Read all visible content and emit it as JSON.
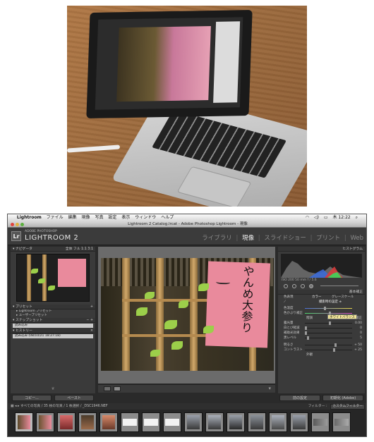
{
  "menubar": {
    "apple": "",
    "app": "Lightroom",
    "items": [
      "ファイル",
      "編集",
      "現像",
      "写真",
      "設定",
      "表示",
      "ウィンドウ",
      "ヘルプ"
    ],
    "clock": "木 12:22"
  },
  "window": {
    "title": "Lightroom 2 Catalog.lrcat - Adobe Photoshop Lightroom - 現像"
  },
  "identity": {
    "logo": "Lr",
    "adobe": "ADOBE PHOTOSHOP",
    "product": "LIGHTROOM 2",
    "modules": [
      "ライブラリ",
      "現像",
      "スライドショー",
      "プリント",
      "Web"
    ],
    "active_module": "現像"
  },
  "left_panel": {
    "navigator": {
      "label": "ナビゲータ",
      "zoom": "全体  フル  1:1  3:1"
    },
    "presets": {
      "label": "プリセット",
      "items": [
        "Lightroom プリセット",
        "ユーザープリセット"
      ]
    },
    "snapshots": {
      "label": "スナップショット",
      "items": [
        "読み込み"
      ]
    },
    "history": {
      "label": "ヒストリー",
      "items": [
        "読み込み (08/10/21 18:27:18)"
      ]
    },
    "copy_button": "コピー...",
    "paste_button": "ペースト"
  },
  "right_panel": {
    "histogram": {
      "label": "ヒストグラム",
      "info": "ISO 200     50 mm     f / 5.6"
    },
    "basic": {
      "label": "基本補正",
      "treatment_label": "色表現",
      "treatment_options": [
        "カラー",
        "グレースケール"
      ],
      "wb_label": "ホワイトバランス :",
      "wb_value": "撮影時の設定 ≑",
      "rows": [
        {
          "label": "色温度",
          "value": ""
        },
        {
          "label": "色かぶり補正",
          "value": ""
        }
      ],
      "tone_label": "階調",
      "tone_auto": "自動補正",
      "tone_rows": [
        {
          "label": "露光量",
          "value": "0.00"
        },
        {
          "label": "白とび軽減",
          "value": "0"
        },
        {
          "label": "補助光効果",
          "value": "0"
        },
        {
          "label": "黒レベル",
          "value": "5"
        },
        {
          "label": "明るさ",
          "value": "+ 50"
        },
        {
          "label": "コントラスト",
          "value": "+ 25"
        }
      ],
      "presence_label": "外観"
    },
    "tooltip": "ホワイトバランス",
    "prev_button": "前の設定",
    "reset_button": "初期化 (Adobe)"
  },
  "filmstrip": {
    "path": "すべての写真 / 35 枚の写真 / 1 枚選択 / _DSC1946.NEF",
    "filter_label": "フィルター :",
    "filter_value": "カスタムフィルター"
  },
  "colors": {
    "panel": "#3a3a3a",
    "background": "#2a2a2a",
    "active_text": "#f0f0f0",
    "inactive_text": "#8a8a8a",
    "tooltip": "#f3e79a"
  }
}
